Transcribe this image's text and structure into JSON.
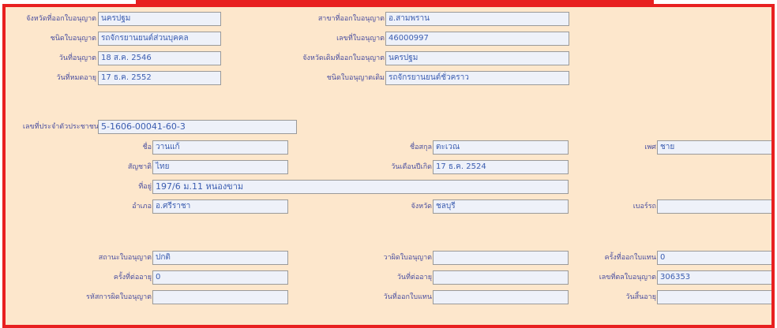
{
  "accent": "#e82020",
  "label_color": "#4a4fa0",
  "value_color": "#3b5db0",
  "rows": [
    {
      "label": "จังหวัดที่ออกใบอนุญาต",
      "value": "นครปฐม"
    },
    {
      "label": "สาขาที่ออกใบอนุญาต",
      "value": "อ.สามพราน"
    },
    {
      "label": "ชนิดใบอนุญาต",
      "value": "รถจักรยานยนต์ส่วนบุคคล"
    },
    {
      "label": "เลขที่ใบอนุญาต",
      "value": "46000997"
    },
    {
      "label": "วันที่อนุญาต",
      "value": "18 ส.ค. 2546"
    },
    {
      "label": "จังหวัดเดิมที่ออกใบอนุญาต",
      "value": "นครปฐม"
    },
    {
      "label": "วันที่หมดอายุ",
      "value": "17 ธ.ค. 2552"
    },
    {
      "label": "ชนิดใบอนุญาตเดิม",
      "value": "รถจักรยานยนต์ชั่วคราว"
    }
  ],
  "person": {
    "id_label": "เลขที่ประจำตัวประชาชน",
    "id_value": "5-1606-00041-60-3",
    "name_label": "ชื่อ",
    "name_value": "วานแก้",
    "surname_label": "ชื่อสกุล",
    "surname_value": "ตะเวณ",
    "sex_label": "เพศ",
    "sex_value": "ชาย",
    "nationality_label": "สัญชาติ",
    "nationality_value": "ไทย",
    "birth_label": "วันเดือนปีเกิด",
    "birth_value": "17 ธ.ค. 2524",
    "address_label": "ที่อยู่",
    "address_value": "197/6 ม.11 หนองขาม",
    "district_label": "อำเภอ",
    "district_value": "อ.ศรีราชา",
    "province_label": "จังหวัด",
    "province_value": "ชลบุรี",
    "postal_label": "เบอร์รถ",
    "postal_value": ""
  },
  "status": {
    "status_label": "สถานะใบอนุญาต",
    "status_value": "ปกติ",
    "suspend_label": "วาผิดใบอนุญาต",
    "suspend_value": "",
    "print_count_label": "ครั้งที่ออกใบแทน",
    "print_count_value": "0",
    "count_label": "ครั้งที่ต่ออายุ",
    "count_value": "0",
    "date_label": "วันที่ต่ออายุ",
    "date_value": "",
    "ref_label": "เลขที่ตลใบอนุญาต",
    "ref_value": "306353",
    "code_label": "รหัสการผิดใบอนุญาต",
    "code_value": "",
    "issue_label": "วันที่ออกใบแทน",
    "issue_value": "",
    "note_label": "วันสิ้นอายุ",
    "note_value": ""
  }
}
